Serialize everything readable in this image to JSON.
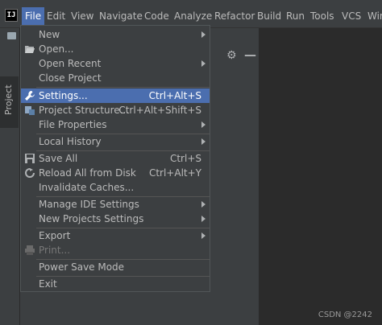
{
  "app": {
    "logo_text": "IJ"
  },
  "menubar": {
    "items": [
      "File",
      "Edit",
      "View",
      "Navigate",
      "Code",
      "Analyze",
      "Refactor",
      "Build",
      "Run",
      "Tools",
      "VCS",
      "Wind"
    ]
  },
  "toolwindow": {
    "project_tab": "Project"
  },
  "file_menu": {
    "new": "New",
    "open": "Open...",
    "open_recent": "Open Recent",
    "close_project": "Close Project",
    "settings": "Settings...",
    "settings_shortcut": "Ctrl+Alt+S",
    "project_structure": "Project Structure...",
    "project_structure_shortcut": "Ctrl+Alt+Shift+S",
    "file_properties": "File Properties",
    "local_history": "Local History",
    "save_all": "Save All",
    "save_all_shortcut": "Ctrl+S",
    "reload": "Reload All from Disk",
    "reload_shortcut": "Ctrl+Alt+Y",
    "invalidate": "Invalidate Caches...",
    "manage_ide": "Manage IDE Settings",
    "new_projects": "New Projects Settings",
    "export": "Export",
    "print": "Print...",
    "power_save": "Power Save Mode",
    "exit": "Exit"
  },
  "watermark": "CSDN @2242",
  "colors": {
    "selection": "#4b6eaf",
    "menu_bg": "#3c3f41",
    "editor_bg": "#2b2b2b"
  }
}
